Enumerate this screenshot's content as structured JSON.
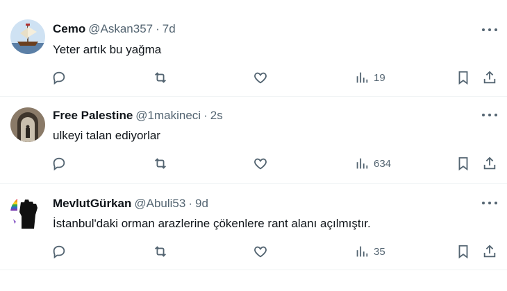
{
  "tweets": [
    {
      "name": "Cemo",
      "handle": "@Askan357",
      "time": "7d",
      "text": "Yeter artık bu yağma",
      "views": "19",
      "avatar": "ship-avatar"
    },
    {
      "name": "Free Palestine",
      "handle": "@1makineci",
      "time": "2s",
      "text": "ulkeyi talan ediyorlar",
      "views": "634",
      "avatar": "archway-avatar"
    },
    {
      "name": "MevlutGürkan",
      "handle": "@Abuli53",
      "time": "9d",
      "text": "İstanbul'daki orman arazlerine çökenlere rant alanı açılmıştır.",
      "views": "35",
      "avatar": "raised-fist-avatar"
    }
  ],
  "separator": "·",
  "colors": {
    "text": "#0f1419",
    "secondary": "#536471",
    "divider": "#eff3f4"
  }
}
